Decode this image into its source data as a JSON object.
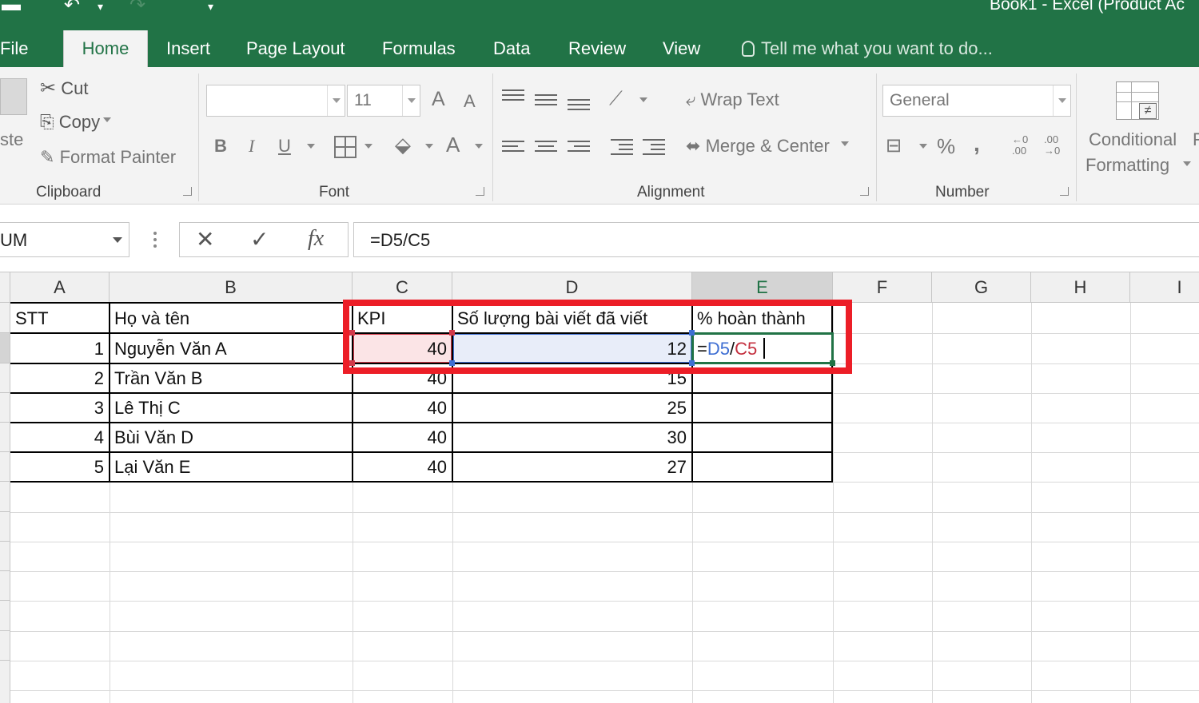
{
  "title_bar": {
    "title": "Book1 - Excel (Product Ac"
  },
  "tabs": [
    {
      "label": "File"
    },
    {
      "label": "Home"
    },
    {
      "label": "Insert"
    },
    {
      "label": "Page Layout"
    },
    {
      "label": "Formulas"
    },
    {
      "label": "Data"
    },
    {
      "label": "Review"
    },
    {
      "label": "View"
    }
  ],
  "active_tab": "Home",
  "tell_me": "Tell me what you want to do...",
  "ribbon": {
    "clipboard": {
      "paste_label": "ste",
      "cut": "Cut",
      "copy": "Copy",
      "format_painter": "Format Painter",
      "group_label": "Clipboard"
    },
    "font": {
      "font_name": "",
      "font_size": "11",
      "bold": "B",
      "italic": "I",
      "underline": "U",
      "font_color_glyph": "A",
      "grow_glyph": "A",
      "shrink_glyph": "A",
      "group_label": "Font"
    },
    "alignment": {
      "wrap_text": "Wrap Text",
      "merge_center": "Merge & Center",
      "group_label": "Alignment"
    },
    "number": {
      "format": "General",
      "percent": "%",
      "comma": ",",
      "group_label": "Number"
    },
    "styles": {
      "conditional_line1": "Conditional",
      "conditional_line2": "Formatting"
    }
  },
  "formula_bar": {
    "name_box": "UM",
    "cancel": "✕",
    "enter": "✓",
    "fx": "fx",
    "formula": "=D5/C5"
  },
  "columns": [
    "A",
    "B",
    "C",
    "D",
    "E",
    "F",
    "G",
    "H",
    "I"
  ],
  "selected_column": "E",
  "table": {
    "headers": [
      "STT",
      "Họ và tên",
      "KPI",
      "Số lượng bài viết đã viết",
      "% hoàn thành"
    ],
    "rows": [
      {
        "stt": "1",
        "name": "Nguyễn Văn A",
        "kpi": "40",
        "count": "12"
      },
      {
        "stt": "2",
        "name": "Trần Văn B",
        "kpi": "40",
        "count": "15"
      },
      {
        "stt": "3",
        "name": "Lê Thị C",
        "kpi": "40",
        "count": "25"
      },
      {
        "stt": "4",
        "name": "Bùi Văn D",
        "kpi": "40",
        "count": "30"
      },
      {
        "stt": "5",
        "name": "Lại Văn E",
        "kpi": "40",
        "count": "27"
      }
    ]
  },
  "edit_cell": {
    "eq": "=",
    "ref1": "D5",
    "slash": "/",
    "ref2": "C5"
  },
  "colors": {
    "excel_green": "#217346",
    "highlight_red": "#ec1e27",
    "ref_blue": "#3f6fd3",
    "ref_red": "#c4303f"
  }
}
